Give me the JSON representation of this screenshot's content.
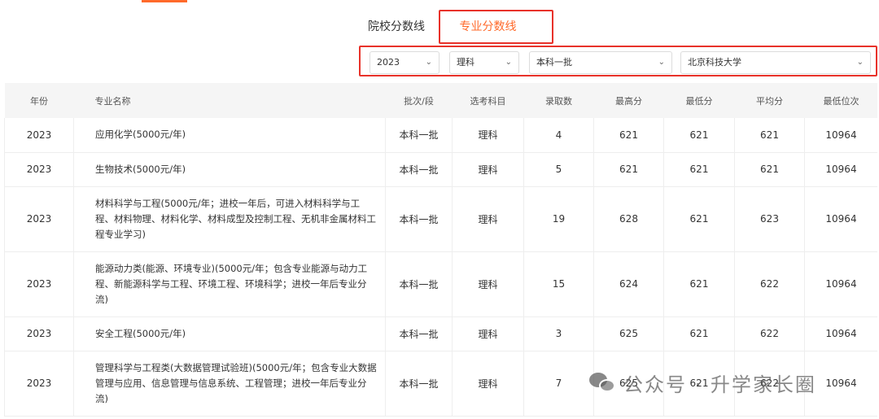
{
  "tabs": {
    "school_line": "院校分数线",
    "major_line": "专业分数线",
    "active": "major_line"
  },
  "filters": {
    "year": "2023",
    "subject": "理科",
    "batch": "本科一批",
    "school": "北京科技大学"
  },
  "table": {
    "headers": [
      "年份",
      "专业名称",
      "批次/段",
      "选考科目",
      "录取数",
      "最高分",
      "最低分",
      "平均分",
      "最低位次"
    ],
    "rows": [
      {
        "year": "2023",
        "name": "应用化学(5000元/年)",
        "batch": "本科一批",
        "subject": "理科",
        "count": "4",
        "max": "621",
        "min": "621",
        "avg": "621",
        "rank": "10964"
      },
      {
        "year": "2023",
        "name": "生物技术(5000元/年)",
        "batch": "本科一批",
        "subject": "理科",
        "count": "5",
        "max": "621",
        "min": "621",
        "avg": "621",
        "rank": "10964"
      },
      {
        "year": "2023",
        "name": "材料科学与工程(5000元/年；进校一年后，可进入材料科学与工程、材料物理、材料化学、材料成型及控制工程、无机非金属材料工程专业学习)",
        "batch": "本科一批",
        "subject": "理科",
        "count": "19",
        "max": "628",
        "min": "621",
        "avg": "623",
        "rank": "10964"
      },
      {
        "year": "2023",
        "name": "能源动力类(能源、环境专业)(5000元/年；包含专业能源与动力工程、新能源科学与工程、环境工程、环境科学；进校一年后专业分流)",
        "batch": "本科一批",
        "subject": "理科",
        "count": "15",
        "max": "624",
        "min": "621",
        "avg": "622",
        "rank": "10964"
      },
      {
        "year": "2023",
        "name": "安全工程(5000元/年)",
        "batch": "本科一批",
        "subject": "理科",
        "count": "3",
        "max": "625",
        "min": "621",
        "avg": "622",
        "rank": "10964"
      },
      {
        "year": "2023",
        "name": "管理科学与工程类(大数据管理试验班)(5000元/年；包含专业大数据管理与应用、信息管理与信息系统、工程管理；进校一年后专业分流)",
        "batch": "本科一批",
        "subject": "理科",
        "count": "7",
        "max": "625",
        "min": "621",
        "avg": "622",
        "rank": "10964"
      }
    ]
  },
  "watermark": "公众号 · 升学家长圈",
  "colors": {
    "accent": "#ff6a2b",
    "highlight_box": "#e8322a",
    "header_bg": "#f5f5f5"
  }
}
